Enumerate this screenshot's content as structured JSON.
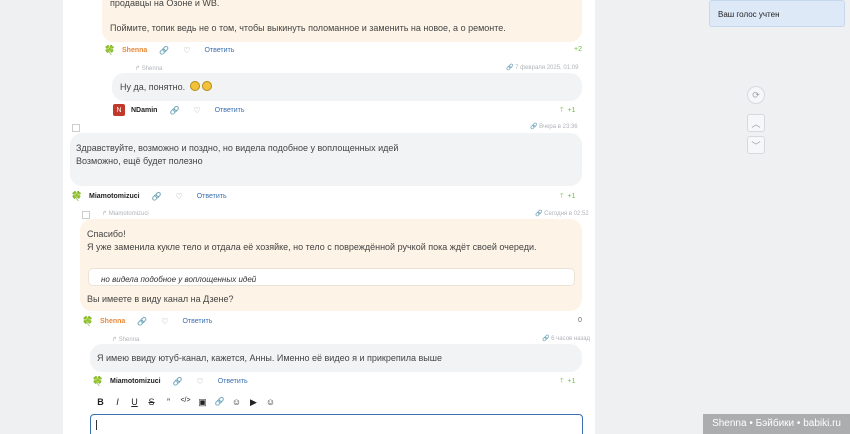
{
  "comments": [
    {
      "id": "c1",
      "text_top": "продавцы на Озоне и WB.",
      "text_main": "Поймите, топик ведь не о том, чтобы выкинуть поломанное и заменить на новое, а о ремонте.",
      "author": "Shenna",
      "reply_label": "Ответить",
      "score": "+2"
    },
    {
      "id": "c2",
      "reply_to": "Shenna",
      "time": "7 февраля 2025, 01:09",
      "text": "Ну да, понятно.",
      "author": "NDamin",
      "reply_label": "Ответить",
      "score": "+1"
    },
    {
      "id": "c3",
      "time": "Вчера в 23:36",
      "text_line1": "Здравствуйте, возможно и поздно, но видела подобное у воплощенных идей",
      "text_line2": "Возможно, ещё будет полезно",
      "author": "Miamotomizuci",
      "reply_label": "Ответить",
      "score": "+1"
    },
    {
      "id": "c4",
      "reply_to": "Miamotomizuci",
      "time": "Сегодня в 02:52",
      "text_line1": "Спасибо!",
      "text_line2": "Я уже заменила кукле тело и отдала её хозяйке, но тело с повреждённой ручкой пока ждёт своей очереди.",
      "quote": "но видела подобное у воплощенных идей",
      "text_line3": "Вы имеете в виду канал на Дзене?",
      "author": "Shenna",
      "reply_label": "Ответить",
      "score": "0"
    },
    {
      "id": "c5",
      "reply_to": "Shenna",
      "time": "6 часов назад",
      "text": "Я имею ввиду ютуб-канал, кажется, Анны. Именно её видео я и прикрепила выше",
      "author": "Miamotomizuci",
      "reply_label": "Ответить",
      "score": "+1"
    }
  ],
  "toolbar": {
    "bold": "B",
    "italic": "I",
    "underline": "U",
    "strike": "S",
    "quote": "”",
    "code": "</>",
    "image": "▣",
    "link": "🔗",
    "user": "☺",
    "media": "▶",
    "emoji": "☺"
  },
  "notification": {
    "text": "Ваш голос учтен"
  },
  "watermark": "Shenna • Бэйбики • babiki.ru",
  "icons": {
    "link": "link-icon",
    "like": "heart-icon",
    "arrow_up": "arrow-up-icon",
    "reply_arrow": "reply-arrow-icon",
    "refresh": "refresh-icon",
    "chevron_up": "chevron-up-icon",
    "chevron_down": "chevron-down-icon"
  },
  "colors": {
    "accent": "#3a6fb0",
    "positive": "#6abf3a",
    "peach": "#fdf3e6",
    "author_orange": "#e8883a"
  }
}
